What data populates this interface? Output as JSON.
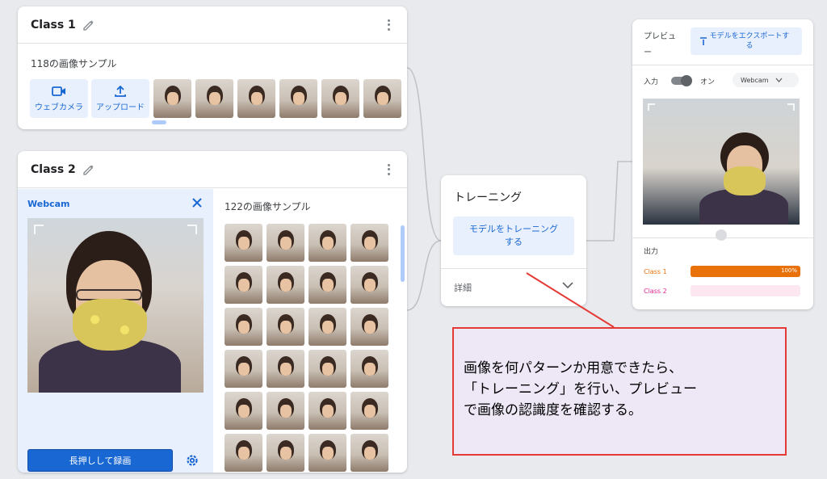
{
  "class1": {
    "title": "Class 1",
    "samples_label": "118の画像サンプル",
    "webcam_label": "ウェブカメラ",
    "upload_label": "アップロード"
  },
  "class2": {
    "title": "Class 2",
    "webcam_title": "Webcam",
    "record_label": "長押しして録画",
    "samples_label": "122の画像サンプル"
  },
  "training": {
    "title": "トレーニング",
    "train_button": "モデルをトレーニング\nする",
    "details_label": "詳細"
  },
  "preview": {
    "title": "プレビュー",
    "export_button": "モデルをエクスポートする",
    "input_label": "入力",
    "on_label": "オン",
    "camera_select": "Webcam",
    "output_label": "出力",
    "classes": [
      {
        "name": "Class 1",
        "confidence": 100,
        "pct_label": "100%",
        "color": "#e8710a",
        "track": "#fce8d5"
      },
      {
        "name": "Class 2",
        "confidence": 0,
        "pct_label": "",
        "color": "#e52592",
        "track": "#fde7f0"
      }
    ]
  },
  "note": {
    "text": "画像を何パターンか用意できたら、\n「トレーニング」を行い、プレビュー\nで画像の認識度を確認する。"
  },
  "colors": {
    "accent": "#1967d2",
    "accent_light": "#e8f0fe",
    "note_border": "#e53935",
    "note_bg": "#ede7f6"
  }
}
